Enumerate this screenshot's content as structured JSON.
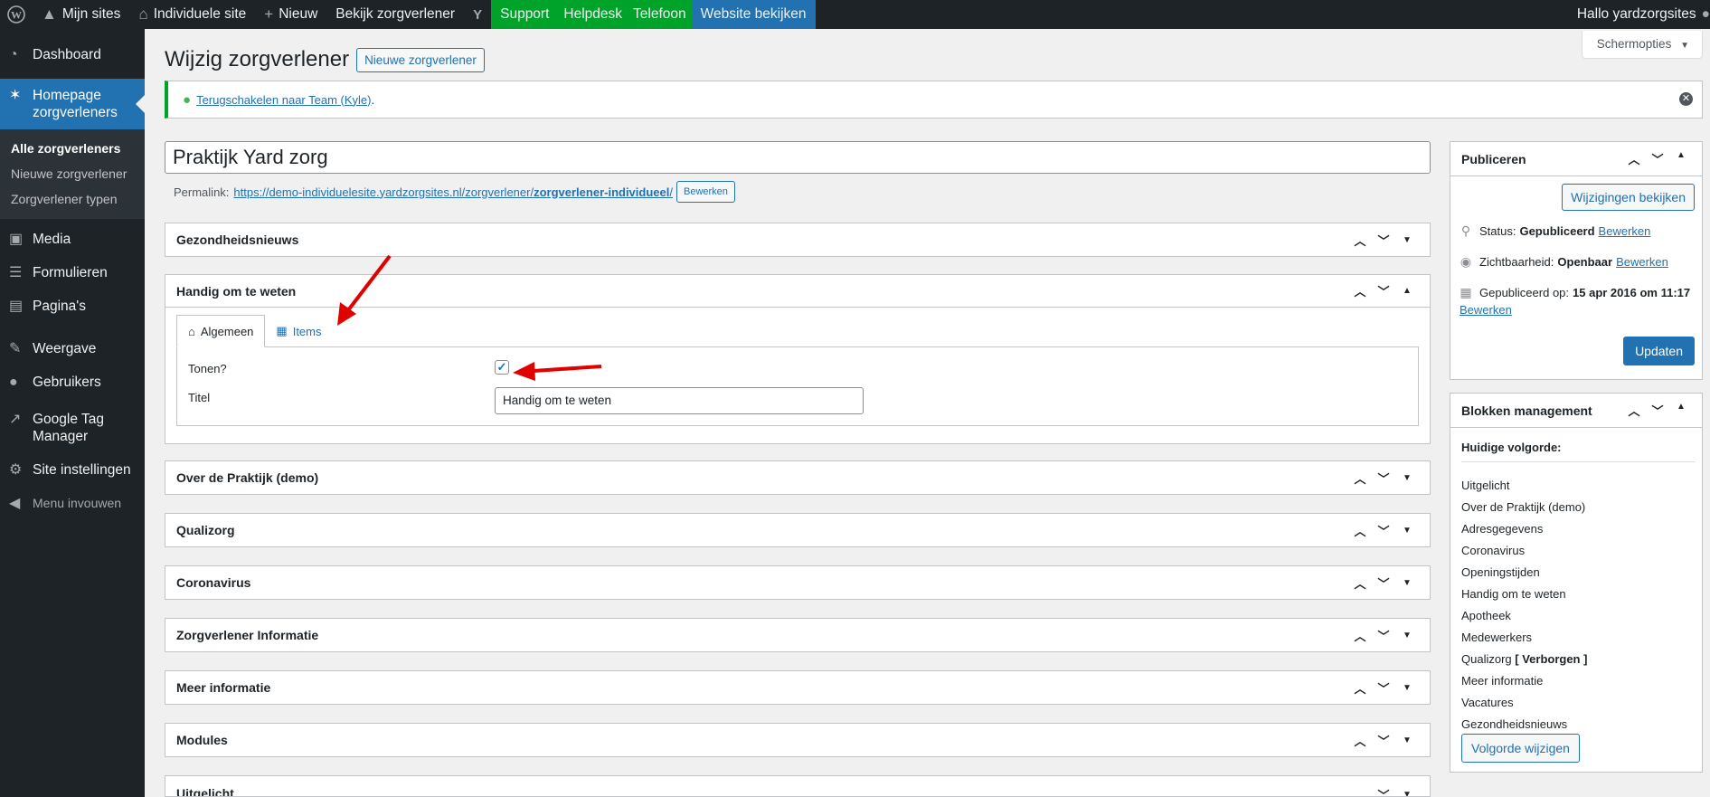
{
  "adminbar": {
    "items": [
      {
        "name": "wp-logo",
        "label": ""
      },
      {
        "name": "mijn-sites",
        "label": "Mijn sites"
      },
      {
        "name": "individuele-site",
        "label": "Individuele site"
      },
      {
        "name": "nieuw",
        "label": "Nieuw"
      },
      {
        "name": "bekijk-zorgverlener",
        "label": "Bekijk zorgverlener"
      },
      {
        "name": "yoast",
        "label": ""
      },
      {
        "name": "support",
        "label": "Support"
      },
      {
        "name": "helpdesk",
        "label": "Helpdesk"
      },
      {
        "name": "telefoon",
        "label": "Telefoon"
      },
      {
        "name": "website-bekijken",
        "label": "Website bekijken"
      }
    ],
    "greeting": "Hallo yardzorgsites"
  },
  "sidebar": {
    "items": [
      {
        "label": "Dashboard",
        "icon": "gauge-icon"
      },
      {
        "label": "Homepage zorgverleners",
        "icon": "person-icon",
        "active": true
      },
      {
        "label": "Media",
        "icon": "media-icon"
      },
      {
        "label": "Formulieren",
        "icon": "forms-icon"
      },
      {
        "label": "Pagina's",
        "icon": "pages-icon"
      },
      {
        "label": "Weergave",
        "icon": "brush-icon"
      },
      {
        "label": "Gebruikers",
        "icon": "users-icon"
      },
      {
        "label": "Google Tag Manager",
        "icon": "chart-icon"
      },
      {
        "label": "Site instellingen",
        "icon": "gear-icon"
      },
      {
        "label": "Menu invouwen",
        "icon": "collapse-icon"
      }
    ],
    "submenu": [
      "Alle zorgverleners",
      "Nieuwe zorgverlener",
      "Zorgverlener typen"
    ]
  },
  "header": {
    "title": "Wijzig zorgverlener",
    "new_button": "Nieuwe zorgverlener",
    "screen_options": "Schermopties"
  },
  "notice": {
    "link": "Terugschakelen naar Team (Kyle)",
    "suffix": "."
  },
  "post": {
    "title": "Praktijk Yard zorg",
    "permalink_label": "Permalink:",
    "permalink_base": "https://demo-individuelesite.yardzorgsites.nl/zorgverlener/",
    "permalink_slug": "zorgverlener-individueel",
    "permalink_end": "/",
    "permalink_edit": "Bewerken"
  },
  "metaboxes": {
    "gezondheidsnieuws": "Gezondheidsnieuws",
    "handig": "Handig om te weten",
    "over": "Over de Praktijk (demo)",
    "qualizorg": "Qualizorg",
    "coronavirus": "Coronavirus",
    "zorgverlener_info": "Zorgverlener Informatie",
    "meer_info": "Meer informatie",
    "modules": "Modules",
    "uitgelicht": "Uitgelicht"
  },
  "handig_tabs": {
    "tab_general": "Algemeen",
    "tab_items": "Items",
    "show_label": "Tonen?",
    "show_checked": true,
    "title_label": "Titel",
    "title_value": "Handig om te weten"
  },
  "publish": {
    "title": "Publiceren",
    "preview_button": "Wijzigingen bekijken",
    "status_label": "Status:",
    "status_value": "Gepubliceerd",
    "visibility_label": "Zichtbaarheid:",
    "visibility_value": "Openbaar",
    "published_label": "Gepubliceerd op:",
    "published_value": "15 apr 2016 om 11:17",
    "edit_link": "Bewerken",
    "update_button": "Updaten"
  },
  "blocks": {
    "title": "Blokken management",
    "current_order_label": "Huidige volgorde:",
    "order": [
      "Uitgelicht",
      "Over de Praktijk (demo)",
      "Adresgegevens",
      "Coronavirus",
      "Openingstijden",
      "Handig om te weten",
      "Apotheek",
      "Medewerkers",
      "Qualizorg",
      "Meer informatie",
      "Vacatures",
      "Gezondheidsnieuws"
    ],
    "hidden_tag": "[ Verborgen ]",
    "change_button": "Volgorde wijzigen"
  },
  "colors": {
    "adminbar_bg": "#1d2327",
    "accent_blue": "#2271b1",
    "support_green": "#00a32a",
    "arrow_red": "#e00000"
  }
}
